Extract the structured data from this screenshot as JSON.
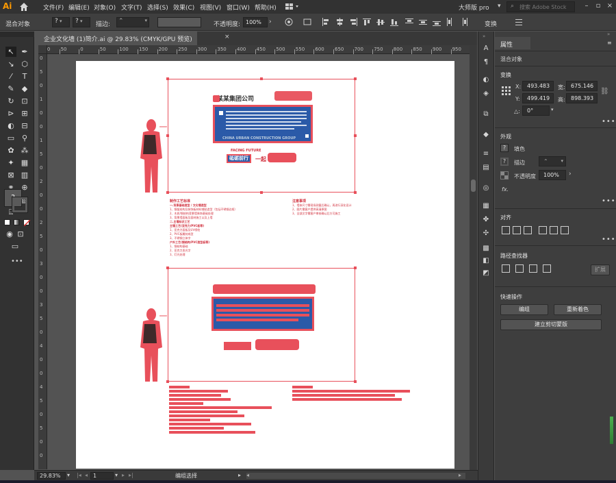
{
  "app": {
    "logo": "Ai"
  },
  "menu": [
    "文件(F)",
    "编辑(E)",
    "对象(O)",
    "文字(T)",
    "选择(S)",
    "效果(C)",
    "视图(V)",
    "窗口(W)",
    "帮助(H)"
  ],
  "workspace": {
    "label": "大师版 pro",
    "search_placeholder": "搜索 Adobe Stock"
  },
  "control": {
    "mixed_objects": "混合对象",
    "stroke_label": "描边:",
    "opacity_label": "不透明度:",
    "opacity_value": "100%",
    "transform_label": "变换"
  },
  "document": {
    "tab_title": "企业文化墙 (1)简介.ai @ 29.83% (CMYK/GPU 预览)",
    "close": "×"
  },
  "ruler": {
    "h_labels": [
      "100",
      "50",
      "0",
      "50",
      "100",
      "150",
      "200",
      "250",
      "300",
      "350",
      "400",
      "450",
      "500",
      "550",
      "600",
      "650",
      "700",
      "750",
      "800",
      "850",
      "900",
      "950"
    ],
    "v_labels": [
      "0",
      "5",
      "0",
      "1",
      "0",
      "0",
      "1",
      "5",
      "0",
      "2",
      "0",
      "0",
      "2",
      "5",
      "0",
      "3",
      "0",
      "0",
      "3",
      "5",
      "0",
      "4",
      "0",
      "0",
      "4",
      "5",
      "0",
      "5",
      "0",
      "0"
    ]
  },
  "artboard": {
    "company": "某某集团公司",
    "english_top": "CHINA URBAN CONSTRUCTION GROUP",
    "facing_future": "FACING FUTURE",
    "slogan_box": "砥砺前行",
    "slogan_tail": "一起",
    "craft_title": "制作工艺标准",
    "notes_title": "注意事项",
    "craft_lines": [
      "一.背景基础造型 / 文化墙造型",
      "1、钢架结构及装饰板材料铺贴造型（包括不锈钢边框）",
      "2、木质/钢结构背景墙装饰基础处理",
      "3、背景墙面板及面材施工以及上墙",
      "二.主墙标识工艺",
      "主墙工艺(亚克力/PVC板等)",
      "1、亚克力面板及UV喷绘",
      "2、PVC板雕刻成型",
      "3、不锈钢立体字",
      "户外工艺(钢结构/PVC造型板等)",
      "1、钢结构基础",
      "2、亚克力发光字",
      "3、灯光处理"
    ],
    "notes_lines": [
      "1、墙体尺寸需现场测量后确认，再进行深化设计",
      "2、图片需客户提供高清原图",
      "3、全部文字需客户审核确认后方可施工"
    ]
  },
  "properties": {
    "tab": "属性",
    "selection": "混合对象",
    "transform": "变换",
    "x_label": "X:",
    "x_value": "493.483",
    "y_label": "Y:",
    "y_value": "499.419",
    "w_label": "宽:",
    "w_value": "675.146",
    "h_label": "高:",
    "h_value": "898.393",
    "angle_label": "△:",
    "angle_value": "0°",
    "appearance": "外观",
    "fill": "填色",
    "stroke": "描边",
    "opacity": "不透明度",
    "opacity_value": "100%",
    "fx": "fx.",
    "align": "对齐",
    "pathfinder": "路径查找器",
    "expand": "扩展",
    "quick_actions": "快速操作",
    "btn_group": "编组",
    "btn_recolor": "重新着色",
    "btn_clip": "建立剪切蒙版"
  },
  "status": {
    "zoom": "29.83%",
    "page": "1",
    "selection": "编组选择"
  },
  "colors": {
    "accent": "#e8505b",
    "brand_blue": "#2b5aa8"
  }
}
